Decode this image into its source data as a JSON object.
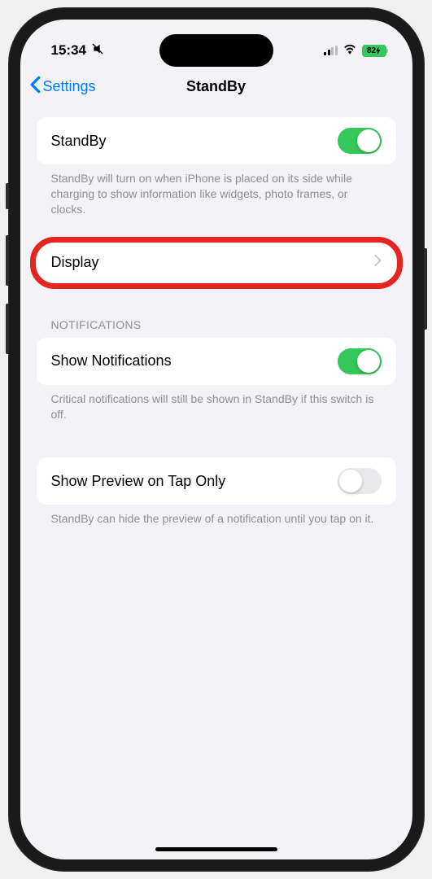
{
  "status": {
    "time": "15:34",
    "battery_text": "82"
  },
  "nav": {
    "back_label": "Settings",
    "title": "StandBy"
  },
  "standby": {
    "label": "StandBy",
    "toggle_on": true,
    "footer": "StandBy will turn on when iPhone is placed on its side while charging to show information like widgets, photo frames, or clocks."
  },
  "display": {
    "label": "Display"
  },
  "notifications": {
    "header": "NOTIFICATIONS",
    "show_label": "Show Notifications",
    "show_toggle_on": true,
    "show_footer": "Critical notifications will still be shown in StandBy if this switch is off.",
    "preview_label": "Show Preview on Tap Only",
    "preview_toggle_on": false,
    "preview_footer": "StandBy can hide the preview of a notification until you tap on it."
  }
}
